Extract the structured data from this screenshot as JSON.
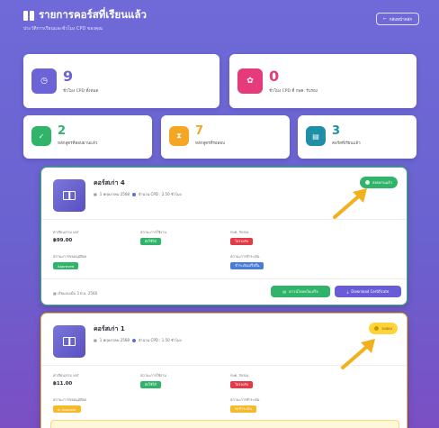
{
  "header": {
    "title": "รายการคอร์สที่เรียนแล้ว",
    "subtitle": "ประวัติการเรียนและชั่วโมง CPD ของคุณ",
    "back_label": "กลับหน้าหลัก"
  },
  "stats": {
    "total_cpd": {
      "value": "9",
      "label": "ชั่วโมง CPD ทั้งหมด",
      "color": "#6c63d6",
      "icon": "clock-icon"
    },
    "approved_cpd": {
      "value": "0",
      "label": "ชั่วโมง CPD ที่ กพค. รับรอง",
      "color": "#e63b7a",
      "icon": "award-icon"
    },
    "passed": {
      "value": "2",
      "label": "หลักสูตรที่สอบผ่านแล้ว",
      "color": "#2fb46a",
      "icon": "check-icon"
    },
    "pending": {
      "value": "7",
      "label": "หลักสูตรที่รอสอบ",
      "color": "#f5a623",
      "icon": "hourglass-icon"
    },
    "enrolled": {
      "value": "3",
      "label": "คอร์สที่เรียนแล้ว",
      "color": "#1f8fa8",
      "icon": "book-icon"
    }
  },
  "courses": [
    {
      "name": "คอร์สเก่า 4",
      "date": "1 พฤษภาคม 2568",
      "cpd": "จำนวน CPD : 2.50 ชั่วโมง",
      "status": "สอบผ่านแล้ว",
      "status_color": "#2fb46a",
      "price_label": "ค่าเรียน/รวม VAT",
      "price": "฿99.00",
      "usage_label": "สถานะการใช้งาน",
      "usage": "ยังใช้ได้",
      "cert_label": "กพค. รับรอง",
      "cert": "ไม่รองรับ",
      "approval_label": "สถานะการขออนุมัติผล",
      "approval": "Approved",
      "payment_label": "สถานะการชำระเงิน",
      "payment": "ชำระเงินเสร็จสิ้น",
      "footer": "เรียนจบเมื่อ 3 มิ.ย. 2568",
      "view_button": "ดาวน์โหลดใบเสร็จ",
      "download_button": "Download Certificate"
    },
    {
      "name": "คอร์สเก่า 1",
      "date": "1 พฤษภาคม 2568",
      "cpd": "จำนวน CPD : 1.50 ชั่วโมง",
      "status": "รอสอบ",
      "status_color": "#ffd43b",
      "price_label": "ค่าเรียน/รวม VAT",
      "price": "฿11.00",
      "usage_label": "สถานะการใช้งาน",
      "usage": "ยังใช้ได้",
      "cert_label": "กพค. รับรอง",
      "cert": "ไม่รองรับ",
      "approval_label": "สถานะการขออนุมัติผล",
      "approval": "In Approve",
      "payment_label": "สถานะการชำระเงิน",
      "payment": "รอชำระเงิน"
    }
  ]
}
